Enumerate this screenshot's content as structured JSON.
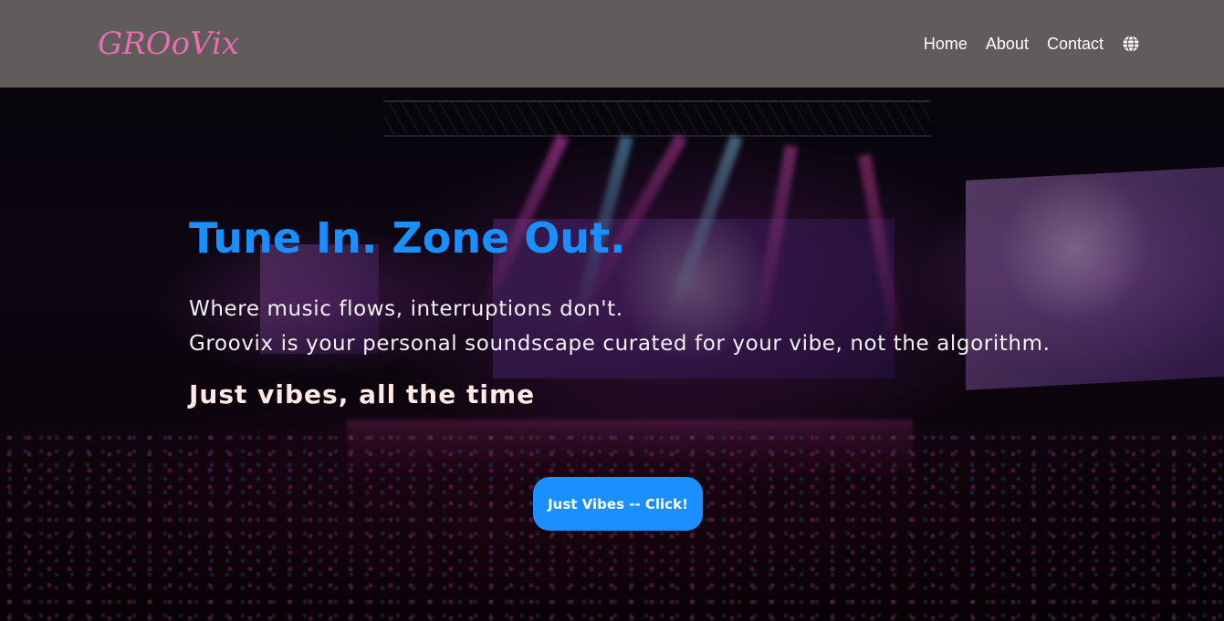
{
  "nav": {
    "logo": "GROoVix",
    "links": [
      "Home",
      "About",
      "Contact"
    ],
    "globe_icon": "globe-icon"
  },
  "hero": {
    "title": "Tune In. Zone Out.",
    "description_line1": "Where music flows, interruptions don't.",
    "description_line2": "Groovix is your personal soundscape curated for your vibe, not the algorithm.",
    "tagline": "Just vibes, all the time",
    "cta_label": "Just Vibes -- Click!"
  },
  "colors": {
    "navbar_bg": "#615b5b",
    "logo": "#e56fae",
    "accent_blue": "#1a8fff",
    "tagline": "#ffe9e6"
  }
}
